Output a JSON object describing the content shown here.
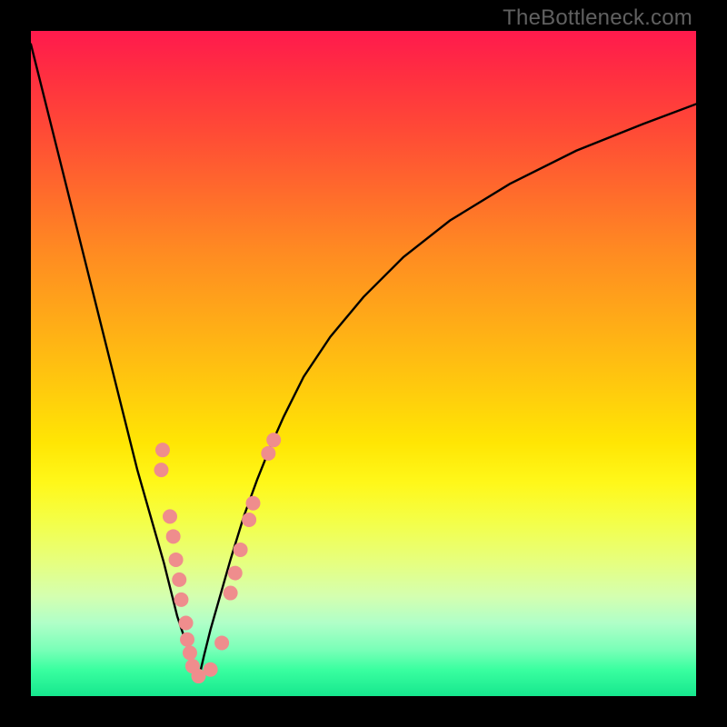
{
  "attribution": "TheBottleneck.com",
  "colors": {
    "frame": "#000000",
    "curve": "#000000",
    "marker_fill": "#ef8d8d",
    "marker_stroke": "#e07676",
    "gradient_top": "#ff1a4d",
    "gradient_bottom": "#16e78e"
  },
  "chart_data": {
    "type": "line",
    "title": "",
    "xlabel": "",
    "ylabel": "",
    "xlim": [
      0,
      100
    ],
    "ylim": [
      0,
      100
    ],
    "curve": {
      "x": [
        0,
        2,
        4,
        6,
        8,
        10,
        12,
        14,
        16,
        18,
        20,
        21,
        22,
        23,
        24,
        24.5,
        25,
        25.5,
        26,
        27,
        28,
        29,
        30,
        32,
        34,
        36,
        38,
        41,
        45,
        50,
        56,
        63,
        72,
        82,
        92,
        100
      ],
      "y": [
        2,
        10,
        18,
        26,
        34,
        42,
        50,
        58,
        66,
        73,
        80,
        84,
        88,
        91,
        94,
        95.5,
        97,
        96.2,
        94,
        90,
        86.5,
        83,
        79.5,
        73,
        67.5,
        62.5,
        58,
        52,
        46,
        40,
        34,
        28.5,
        23,
        18,
        14,
        11
      ]
    },
    "marker_radius_px": 8,
    "markers": {
      "left_branch": [
        {
          "x": 19.8,
          "y": 63.0
        },
        {
          "x": 19.6,
          "y": 66.0
        },
        {
          "x": 20.9,
          "y": 73.0
        },
        {
          "x": 21.4,
          "y": 76.0
        },
        {
          "x": 21.8,
          "y": 79.5
        },
        {
          "x": 22.3,
          "y": 82.5
        },
        {
          "x": 22.6,
          "y": 85.5
        },
        {
          "x": 23.3,
          "y": 89.0
        },
        {
          "x": 23.5,
          "y": 91.5
        },
        {
          "x": 23.9,
          "y": 93.5
        },
        {
          "x": 24.3,
          "y": 95.5
        },
        {
          "x": 25.2,
          "y": 97.0
        }
      ],
      "right_branch": [
        {
          "x": 27.0,
          "y": 96.0
        },
        {
          "x": 28.7,
          "y": 92.0
        },
        {
          "x": 30.0,
          "y": 84.5
        },
        {
          "x": 30.7,
          "y": 81.5
        },
        {
          "x": 31.5,
          "y": 78.0
        },
        {
          "x": 32.8,
          "y": 73.5
        },
        {
          "x": 33.4,
          "y": 71.0
        },
        {
          "x": 35.7,
          "y": 63.5
        },
        {
          "x": 36.5,
          "y": 61.5
        }
      ]
    }
  }
}
